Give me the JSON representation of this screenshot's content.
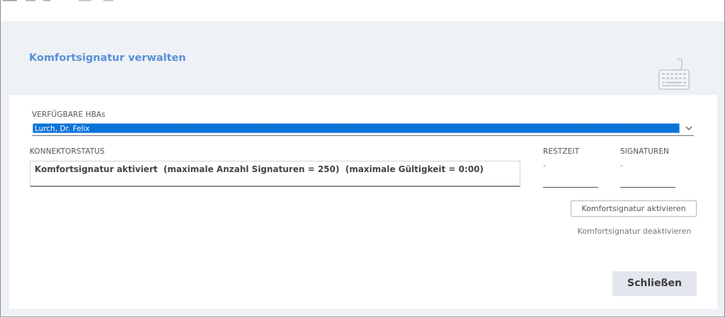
{
  "dialog": {
    "title": "Komfortsignatur verwalten",
    "icon": "keyboard-icon"
  },
  "hba": {
    "label": "VERFÜGBARE  HBAs",
    "selected": "Lurch, Dr. Felix"
  },
  "konnektor": {
    "label": "KONNEKTORSTATUS",
    "status": "Komfortsignatur aktiviert  (maximale Anzahl Signaturen = 250)  (maximale Gültigkeit = 0:00)"
  },
  "restzeit": {
    "label": "RESTZEIT",
    "value": "-"
  },
  "signaturen": {
    "label": "SIGNATUREN",
    "value": "-"
  },
  "buttons": {
    "activate": "Komfortsignatur aktivieren",
    "deactivate": "Komfortsignatur deaktivieren",
    "close": "Schließen"
  },
  "colors": {
    "accent": "#5b8fd6",
    "selection": "#0b73d8",
    "header_bg": "#eef1f6"
  }
}
